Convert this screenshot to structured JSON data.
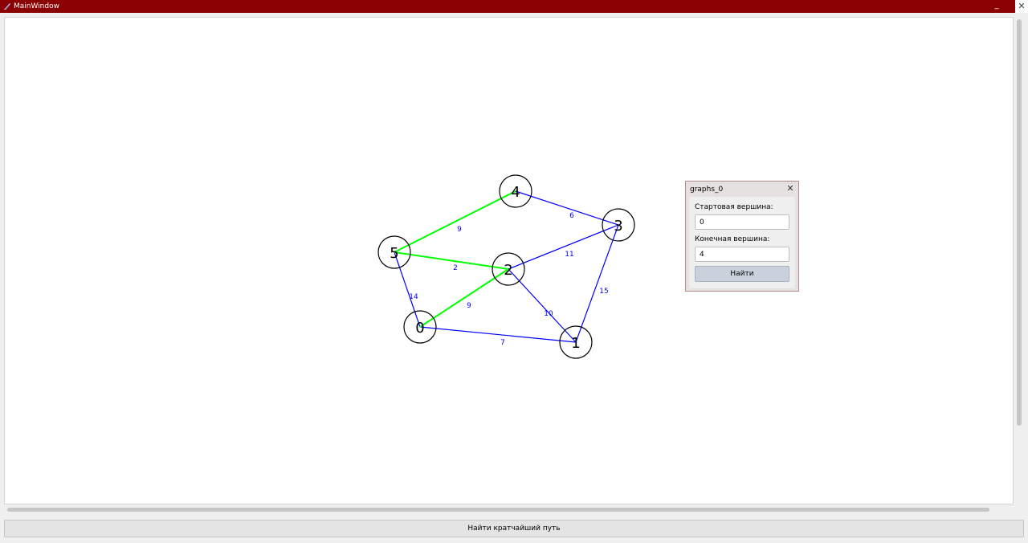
{
  "window": {
    "title": "MainWindow",
    "minimize_glyph": "_",
    "close_glyph": "✕"
  },
  "graph": {
    "vertex_color": "#000000",
    "edge_color": "#0000ff",
    "path_color": "#00ff00",
    "label_color": "#0000ff",
    "vertices": [
      {
        "id": "0",
        "label": "0"
      },
      {
        "id": "1",
        "label": "1"
      },
      {
        "id": "2",
        "label": "2"
      },
      {
        "id": "3",
        "label": "3"
      },
      {
        "id": "4",
        "label": "4"
      },
      {
        "id": "5",
        "label": "5"
      }
    ],
    "edges": [
      {
        "from": "0",
        "to": "1",
        "weight": "7",
        "on_path": false
      },
      {
        "from": "0",
        "to": "2",
        "weight": "9",
        "on_path": true
      },
      {
        "from": "0",
        "to": "5",
        "weight": "14",
        "on_path": false
      },
      {
        "from": "1",
        "to": "2",
        "weight": "10",
        "on_path": false
      },
      {
        "from": "1",
        "to": "3",
        "weight": "15",
        "on_path": false
      },
      {
        "from": "2",
        "to": "3",
        "weight": "11",
        "on_path": false
      },
      {
        "from": "2",
        "to": "5",
        "weight": "2",
        "on_path": true
      },
      {
        "from": "3",
        "to": "4",
        "weight": "6",
        "on_path": false
      },
      {
        "from": "4",
        "to": "5",
        "weight": "9",
        "on_path": true
      }
    ]
  },
  "dialog": {
    "title": "graphs_0",
    "close_glyph": "✕",
    "start_label": "Стартовая вершина:",
    "start_value": "0",
    "end_label": "Конечная вершина:",
    "end_value": "4",
    "find_button": "Найти"
  },
  "bottom_button": "Найти кратчайший путь"
}
